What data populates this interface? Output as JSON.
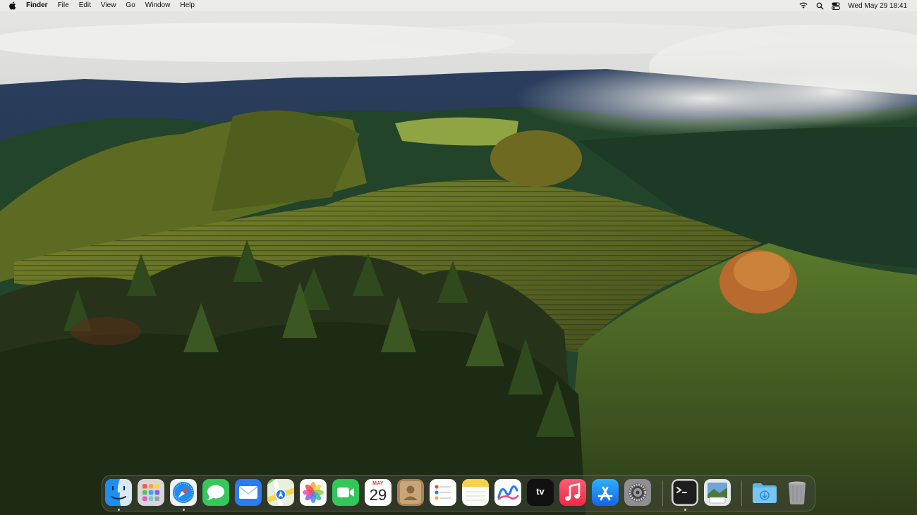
{
  "menubar": {
    "apple_icon": "apple-logo-icon",
    "app_name": "Finder",
    "menus": [
      "File",
      "Edit",
      "View",
      "Go",
      "Window",
      "Help"
    ],
    "status_icons": [
      "wifi-icon",
      "spotlight-search-icon",
      "control-center-icon"
    ],
    "clock": "Wed May 29  18:41"
  },
  "dock": {
    "apps": [
      {
        "name": "Finder",
        "icon": "finder-icon",
        "running": true
      },
      {
        "name": "Launchpad",
        "icon": "launchpad-icon",
        "running": false
      },
      {
        "name": "Safari",
        "icon": "safari-icon",
        "running": true
      },
      {
        "name": "Messages",
        "icon": "messages-icon",
        "running": false
      },
      {
        "name": "Mail",
        "icon": "mail-icon",
        "running": false
      },
      {
        "name": "Maps",
        "icon": "maps-icon",
        "running": false
      },
      {
        "name": "Photos",
        "icon": "photos-icon",
        "running": false
      },
      {
        "name": "FaceTime",
        "icon": "facetime-icon",
        "running": false
      },
      {
        "name": "Calendar",
        "icon": "calendar-icon",
        "running": false
      },
      {
        "name": "Contacts",
        "icon": "contacts-icon",
        "running": false
      },
      {
        "name": "Reminders",
        "icon": "reminders-icon",
        "running": false
      },
      {
        "name": "Notes",
        "icon": "notes-icon",
        "running": false
      },
      {
        "name": "Freeform",
        "icon": "freeform-icon",
        "running": false
      },
      {
        "name": "TV",
        "icon": "apple-tv-icon",
        "running": false
      },
      {
        "name": "Music",
        "icon": "music-icon",
        "running": false
      },
      {
        "name": "App Store",
        "icon": "app-store-icon",
        "running": false
      },
      {
        "name": "System Settings",
        "icon": "system-settings-icon",
        "running": false
      },
      {
        "name": "Terminal",
        "icon": "terminal-icon",
        "running": true
      },
      {
        "name": "Preview",
        "icon": "preview-icon",
        "running": false
      },
      {
        "name": "Downloads",
        "icon": "downloads-folder-icon",
        "running": false
      },
      {
        "name": "Trash",
        "icon": "trash-icon",
        "running": false
      }
    ],
    "calendar": {
      "month": "MAY",
      "day": "29"
    },
    "tv_label": "tv"
  },
  "colors": {
    "menubar_bg": "#ebebe8",
    "accent_blue": "#1a7cf5",
    "calendar_red": "#e8342c"
  }
}
